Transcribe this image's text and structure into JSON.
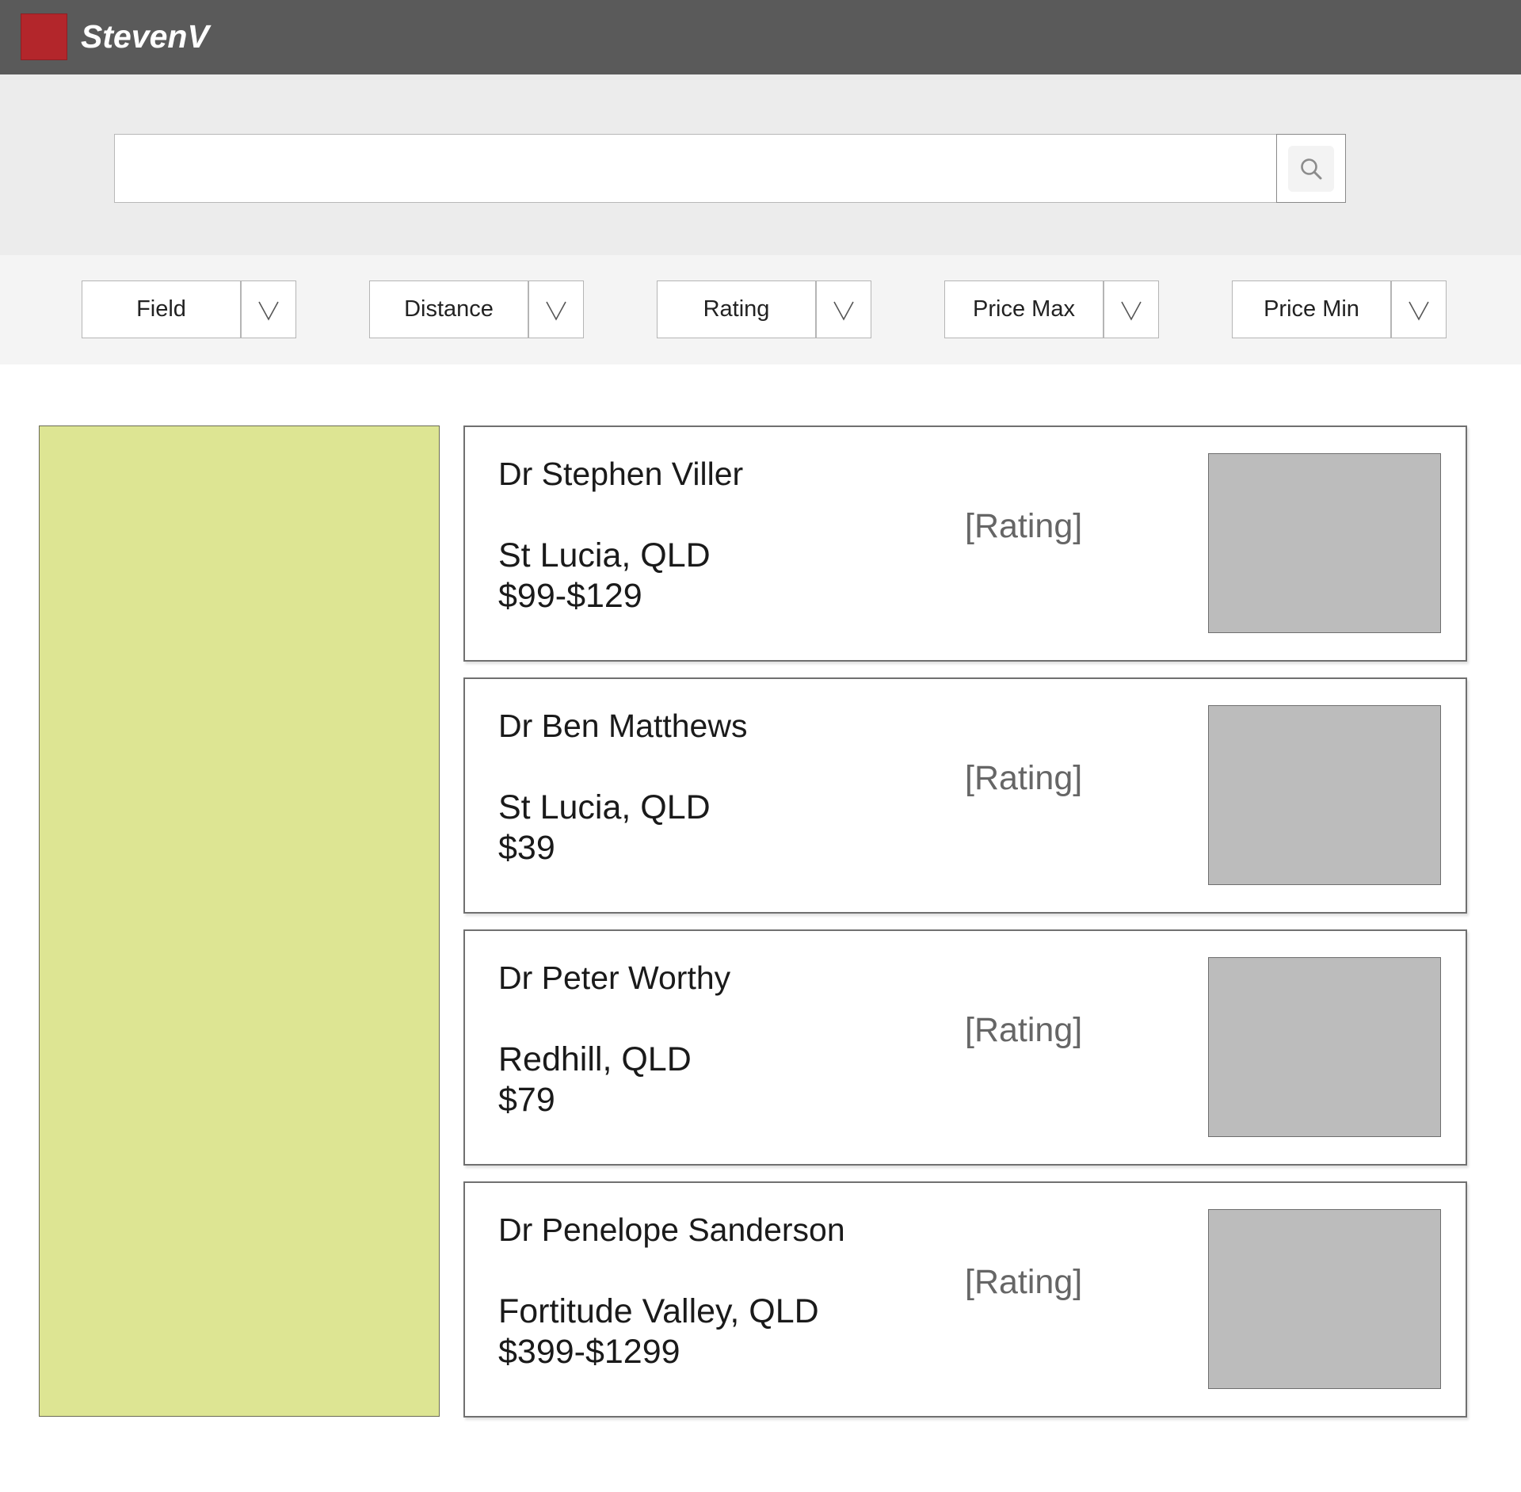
{
  "header": {
    "brand": "StevenV",
    "logo_color": "#b3262b"
  },
  "search": {
    "value": "",
    "placeholder": "",
    "button_icon": "search-icon"
  },
  "filters": [
    {
      "label": "Field",
      "icon": "chevron-down-icon"
    },
    {
      "label": "Distance",
      "icon": "chevron-down-icon"
    },
    {
      "label": "Rating",
      "icon": "chevron-down-icon"
    },
    {
      "label": "Price Max",
      "icon": "chevron-down-icon"
    },
    {
      "label": "Price Min",
      "icon": "chevron-down-icon"
    }
  ],
  "map": {
    "color": "#dde593"
  },
  "results": [
    {
      "name": "Dr Stephen Viller",
      "location": "St Lucia, QLD",
      "price": "$99-$129",
      "rating": "[Rating]"
    },
    {
      "name": "Dr Ben Matthews",
      "location": "St Lucia, QLD",
      "price": "$39",
      "rating": "[Rating]"
    },
    {
      "name": "Dr Peter Worthy",
      "location": "Redhill, QLD",
      "price": "$79",
      "rating": "[Rating]"
    },
    {
      "name": "Dr Penelope Sanderson",
      "location": "Fortitude Valley, QLD",
      "price": "$399-$1299",
      "rating": "[Rating]"
    }
  ]
}
